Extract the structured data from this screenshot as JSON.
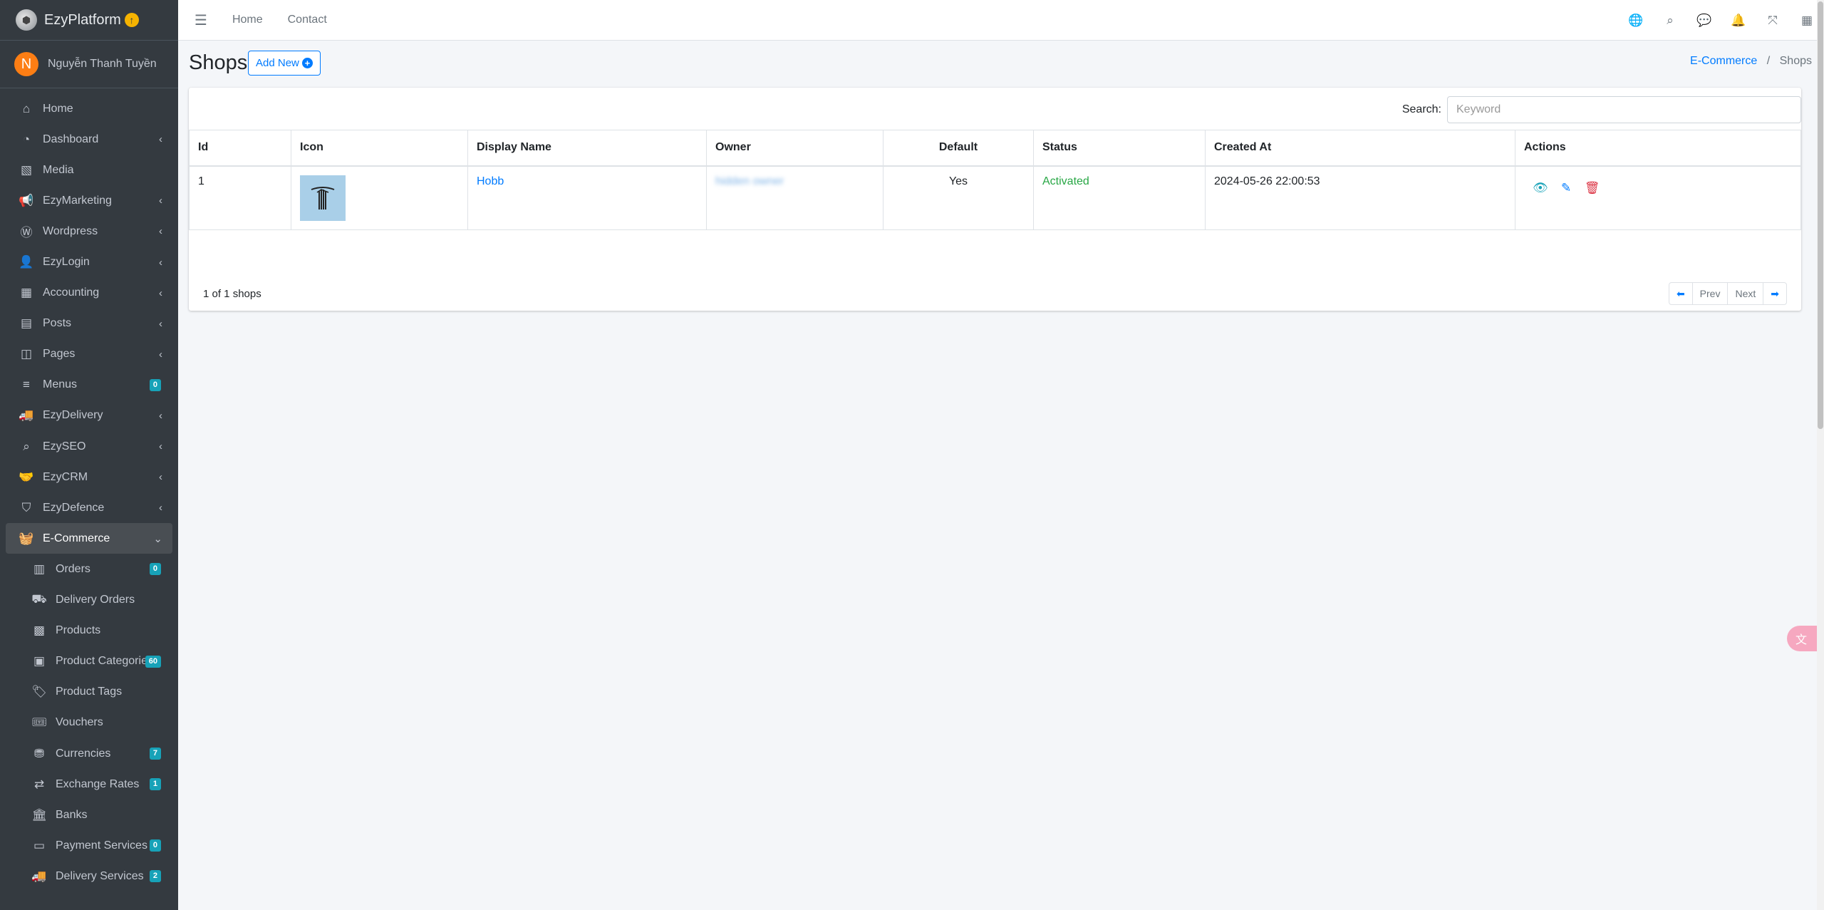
{
  "brand": {
    "name": "EzyPlatform",
    "logo_icon": "platform-logo",
    "upgrade_icon": "upgrade-icon"
  },
  "user": {
    "initial": "N",
    "name": "Nguyễn Thanh Tuyền",
    "avatar_color": "#fd7e14"
  },
  "sidebar": {
    "items": [
      {
        "label": "Home",
        "icon": "home-icon",
        "glyph": "⌂"
      },
      {
        "label": "Dashboard",
        "icon": "dashboard-icon",
        "glyph": "◔",
        "arrow": "‹"
      },
      {
        "label": "Media",
        "icon": "media-icon",
        "glyph": "▧"
      },
      {
        "label": "EzyMarketing",
        "icon": "megaphone-icon",
        "glyph": "📢",
        "arrow": "‹"
      },
      {
        "label": "Wordpress",
        "icon": "wordpress-icon",
        "glyph": "Ⓦ",
        "arrow": "‹"
      },
      {
        "label": "EzyLogin",
        "icon": "user-lock-icon",
        "glyph": "👤",
        "arrow": "‹"
      },
      {
        "label": "Accounting",
        "icon": "calculator-icon",
        "glyph": "▦",
        "arrow": "‹"
      },
      {
        "label": "Posts",
        "icon": "posts-icon",
        "glyph": "▤",
        "arrow": "‹"
      },
      {
        "label": "Pages",
        "icon": "pages-icon",
        "glyph": "◫",
        "arrow": "‹"
      },
      {
        "label": "Menus",
        "icon": "menu-icon",
        "glyph": "≡",
        "badge": "0"
      },
      {
        "label": "EzyDelivery",
        "icon": "truck-icon",
        "glyph": "🚚",
        "arrow": "‹"
      },
      {
        "label": "EzySEO",
        "icon": "seo-search-icon",
        "glyph": "⌕",
        "arrow": "‹"
      },
      {
        "label": "EzyCRM",
        "icon": "handshake-icon",
        "glyph": "🤝",
        "arrow": "‹"
      },
      {
        "label": "EzyDefence",
        "icon": "shield-icon",
        "glyph": "⛉",
        "arrow": "‹"
      },
      {
        "label": "E-Commerce",
        "icon": "basket-icon",
        "glyph": "🧺",
        "arrow": "⌄",
        "active": true
      },
      {
        "label": "Orders",
        "icon": "orders-icon",
        "glyph": "▥",
        "badge": "0",
        "sub": true
      },
      {
        "label": "Delivery Orders",
        "icon": "dolly-icon",
        "glyph": "⛟",
        "sub": true
      },
      {
        "label": "Products",
        "icon": "boxes-icon",
        "glyph": "▩",
        "sub": true
      },
      {
        "label": "Product Categories",
        "icon": "clipboard-icon",
        "glyph": "▣",
        "badge": "60",
        "sub": true
      },
      {
        "label": "Product Tags",
        "icon": "tags-icon",
        "glyph": "🏷",
        "sub": true
      },
      {
        "label": "Vouchers",
        "icon": "ticket-icon",
        "glyph": "🎟",
        "sub": true
      },
      {
        "label": "Currencies",
        "icon": "coins-icon",
        "glyph": "⛃",
        "badge": "7",
        "sub": true
      },
      {
        "label": "Exchange Rates",
        "icon": "exchange-icon",
        "glyph": "⇄",
        "badge": "1",
        "sub": true
      },
      {
        "label": "Banks",
        "icon": "bank-icon",
        "glyph": "🏛",
        "sub": true
      },
      {
        "label": "Payment Services",
        "icon": "credit-card-icon",
        "glyph": "▭",
        "badge": "0",
        "sub": true
      },
      {
        "label": "Delivery Services",
        "icon": "truck-icon",
        "glyph": "🚚",
        "badge": "2",
        "sub": true
      }
    ]
  },
  "topbar": {
    "menu_icon": "hamburger-icon",
    "links": [
      "Home",
      "Contact"
    ],
    "right_icons": [
      {
        "name": "globe-icon",
        "glyph": "🌐"
      },
      {
        "name": "search-icon",
        "glyph": "⌕"
      },
      {
        "name": "comments-icon",
        "glyph": "💬"
      },
      {
        "name": "bell-icon",
        "glyph": "🔔"
      },
      {
        "name": "fullscreen-icon",
        "glyph": "⤧"
      },
      {
        "name": "apps-grid-icon",
        "glyph": "▦"
      }
    ]
  },
  "page": {
    "title": "Shops",
    "add_new_label": "Add New",
    "breadcrumb": {
      "parent": "E-Commerce",
      "separator": "/",
      "current": "Shops"
    }
  },
  "search": {
    "label": "Search:",
    "placeholder": "Keyword",
    "value": ""
  },
  "table": {
    "columns": [
      "Id",
      "Icon",
      "Display Name",
      "Owner",
      "Default",
      "Status",
      "Created At",
      "Actions"
    ],
    "rows": [
      {
        "id": "1",
        "icon": "shop-logo-icon",
        "display_name": "Hobb",
        "owner": "hidden owner",
        "default": "Yes",
        "status": "Activated",
        "created_at": "2024-05-26 22:00:53",
        "actions": [
          "view-icon",
          "edit-icon",
          "delete-icon"
        ]
      }
    ]
  },
  "pagination": {
    "summary": "1 of 1 shops",
    "prev_label": "Prev",
    "next_label": "Next"
  },
  "colors": {
    "sidebar_bg": "#343a40",
    "primary": "#007bff",
    "success": "#28a745",
    "danger": "#dc3545",
    "info": "#17a2b8",
    "badge": "#17a2b8"
  }
}
